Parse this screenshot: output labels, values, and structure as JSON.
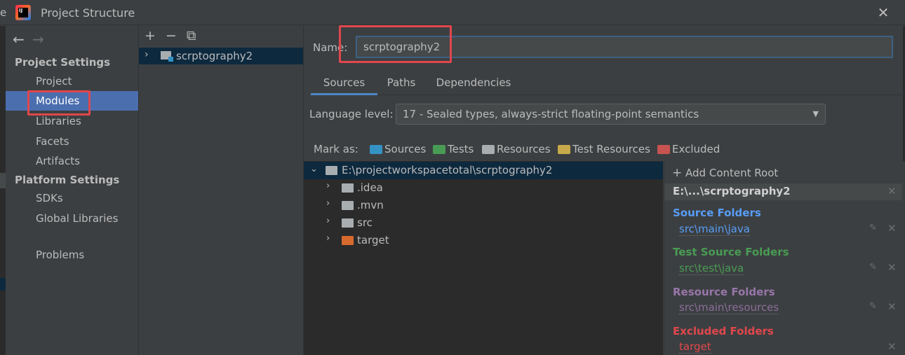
{
  "titlebar": {
    "edge_text": "e",
    "title": "Project Structure",
    "close": "✕"
  },
  "nav": {
    "back": "←",
    "forward": "→",
    "project_settings_heading": "Project Settings",
    "project_settings": [
      "Project",
      "Modules",
      "Libraries",
      "Facets",
      "Artifacts"
    ],
    "platform_settings_heading": "Platform Settings",
    "platform_settings": [
      "SDKs",
      "Global Libraries"
    ],
    "problems": "Problems",
    "selected": "Modules"
  },
  "modules": {
    "toolbar": {
      "add": "+",
      "remove": "−",
      "copy": "⧉"
    },
    "items": [
      {
        "chevron": "›",
        "name": "scrptography2"
      }
    ]
  },
  "module": {
    "name_label": "Name:",
    "name_value": "scrptography2",
    "tabs": [
      "Sources",
      "Paths",
      "Dependencies"
    ],
    "active_tab": "Sources",
    "language_level_label": "Language level:",
    "language_level_value": "17 - Sealed types, always-strict floating-point semantics",
    "mark_as_label": "Mark as:",
    "mark_as": [
      {
        "label": "Sources",
        "color": "#3592c4"
      },
      {
        "label": "Tests",
        "color": "#499c54"
      },
      {
        "label": "Resources",
        "color": "#a8adb0"
      },
      {
        "label": "Test Resources",
        "color": "#c7a84a"
      },
      {
        "label": "Excluded",
        "color": "#c75450"
      }
    ]
  },
  "tree": {
    "root": "E:\\projectworkspacetotal\\scrptography2",
    "children": [
      {
        "name": ".idea",
        "color": "#a8adb0"
      },
      {
        "name": ".mvn",
        "color": "#a8adb0"
      },
      {
        "name": "src",
        "color": "#a8adb0"
      },
      {
        "name": "target",
        "color": "#d76a2d"
      }
    ]
  },
  "content_root": {
    "add_label": "Add Content Root",
    "root_title": "E:\\...\\scrptography2",
    "groups": [
      {
        "title": "Source Folders",
        "path": "src\\main\\java",
        "color": "#589df6"
      },
      {
        "title": "Test Source Folders",
        "path": "src\\test\\java",
        "color": "#499c54"
      },
      {
        "title": "Resource Folders",
        "path": "src\\main\\resources",
        "color": "#9876aa"
      },
      {
        "title": "Excluded Folders",
        "path": "target",
        "color": "#e0474c"
      }
    ]
  },
  "colors": {
    "selection": "#4b6eaf",
    "tree_selection": "#0d293e",
    "highlight_box": "#e0474c"
  }
}
